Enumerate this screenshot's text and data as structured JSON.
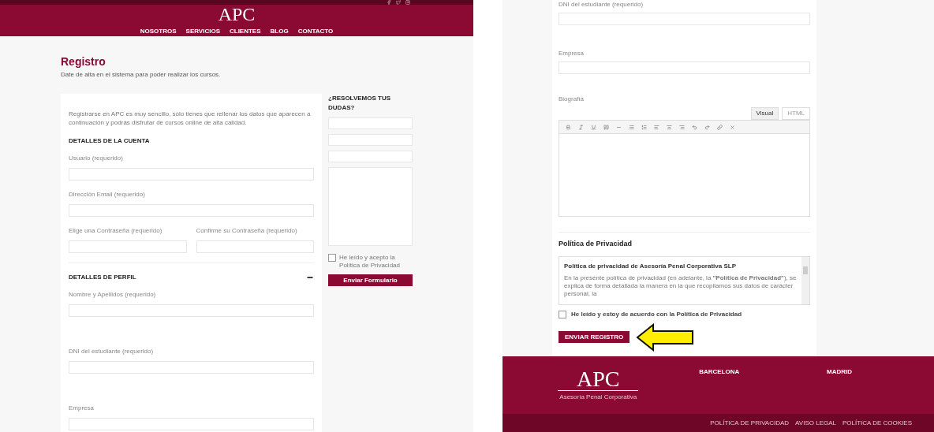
{
  "left_page": {
    "header": {
      "logo": "APC",
      "nav": [
        "NOSOTROS",
        "SERVICIOS",
        "CLIENTES",
        "BLOG",
        "CONTACTO"
      ]
    },
    "title": "Registro",
    "subtitle": "Date de alta en el sistema para poder realizar los cursos.",
    "form": {
      "intro": "Registrarse en APC es muy sencillo, sólo tienes que rellenar los datos que aparecen a continuación y podrás disfrutar de cursos online de alta calidad.",
      "sections": [
        {
          "title": "DETALLES DE LA CUENTA",
          "fields": [
            {
              "label": "Usuario (requerido)",
              "kind": "full"
            },
            {
              "label": "Dirección Email (requerido)",
              "kind": "full"
            },
            {
              "label": "Elige una Contraseña (requerido)",
              "kind": "half"
            },
            {
              "label": "Confirme su Contraseña (requerido)",
              "kind": "half"
            }
          ]
        },
        {
          "title": "DETALLES DE PERFIL",
          "expanded": true,
          "fields": [
            {
              "label": "Nombre y Apellidos (requerido)",
              "kind": "full"
            },
            {
              "label": "DNI del estudiante (requerido)",
              "kind": "full"
            },
            {
              "label": "Empresa",
              "kind": "full"
            }
          ]
        }
      ]
    },
    "sidebar": {
      "title": "¿RESOLVEMOS TUS DUDAS?",
      "consent": {
        "label": "He leído y acepto la Política de Privacidad",
        "checked": false
      },
      "button": "Enviar Formulario"
    }
  },
  "right_page": {
    "fields": [
      {
        "label": "DNI del estudiante (requerido)"
      },
      {
        "label": "Empresa"
      }
    ],
    "editor": {
      "label": "Biografía",
      "tabs": [
        {
          "label": "Visual",
          "selected": true
        },
        {
          "label": "HTML",
          "selected": false
        }
      ]
    },
    "privacy": {
      "title": "Política de Privacidad",
      "heading": "Política de privacidad de Asesoría Penal Corporativa SLP",
      "text": "En la presente política de privacidad (en adelante, la **\"Política de Privacidad\"**), se explica de forma detallada la manera en la que recopilamos sus datos de carácter personal, la",
      "consent": {
        "label": "He leído y estoy de acuerdo con la Política de Privacidad",
        "checked": false
      },
      "button": "ENVIAR REGISTRO"
    },
    "footer": {
      "logo": "APC",
      "tagline": "Asesoría Penal Corporativa",
      "offices": [
        "BARCELONA",
        "MADRID"
      ],
      "links": [
        "POLÍTICA DE PRIVACIDAD",
        "AVISO LEGAL",
        "POLÍTICA DE COOKIES"
      ]
    }
  }
}
